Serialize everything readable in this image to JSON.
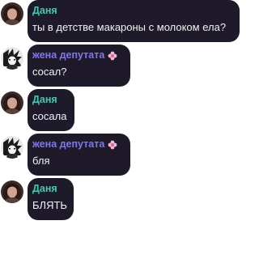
{
  "colors": {
    "bubble": "#1f1a29",
    "text": "#f2f2f4",
    "name_dania": "#42c9b0",
    "name_wife": "#7d77ee"
  },
  "messages": [
    {
      "sender": "Даня",
      "text": "ты в детстве макароны с молоком ела?",
      "avatar": "girl-photo-avatar"
    },
    {
      "sender": "жена депутата",
      "badge": "flower-badge-icon",
      "text": "сосал?",
      "avatar": "anime-character-avatar"
    },
    {
      "sender": "Даня",
      "text": "сосала",
      "avatar": "girl-photo-avatar"
    },
    {
      "sender": "жена депутата",
      "badge": "flower-badge-icon",
      "text": "бля",
      "avatar": "anime-character-avatar"
    },
    {
      "sender": "Даня",
      "text": "БЛЯТЬ",
      "avatar": "girl-photo-avatar"
    }
  ]
}
